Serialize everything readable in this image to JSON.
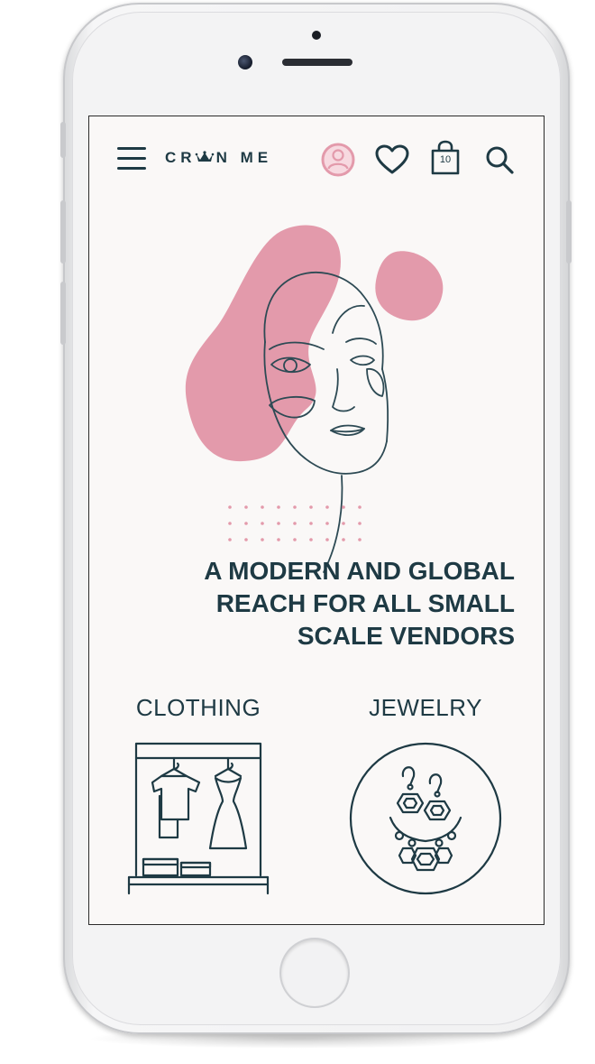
{
  "header": {
    "logo_text_left": "CR",
    "logo_text_right": "N ME",
    "cart_count": "10",
    "icons": [
      "menu-icon",
      "user-icon",
      "heart-icon",
      "shopping-bag-icon",
      "search-icon"
    ]
  },
  "hero": {
    "headline_lines": [
      "A MODERN AND GLOBAL",
      "REACH FOR ALL SMALL",
      "SCALE VENDORS"
    ]
  },
  "categories": [
    {
      "label": "CLOTHING",
      "icon": "clothing-rack-icon"
    },
    {
      "label": "JEWELRY",
      "icon": "jewelry-icon"
    }
  ],
  "colors": {
    "accent_pink": "#e39aab",
    "primary_dark": "#1e3a44",
    "screen_bg": "#faf8f7"
  }
}
